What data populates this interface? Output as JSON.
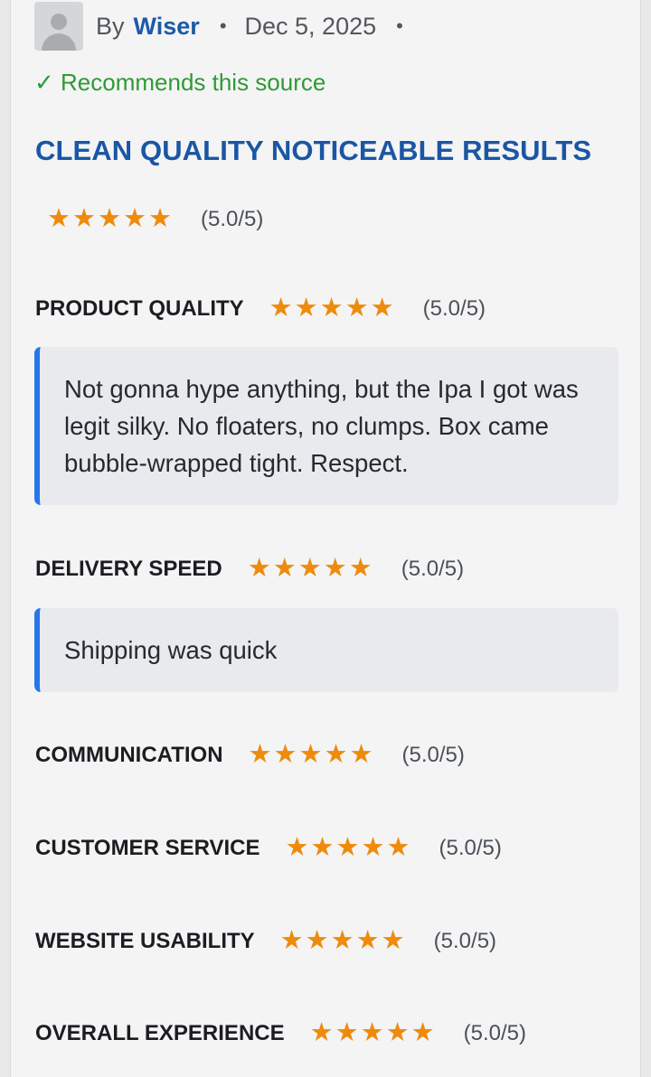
{
  "review": {
    "by_label": "By",
    "author": "Wiser",
    "separator": "•",
    "date": "Dec 5, 2025",
    "recommend_text": "✓ Recommends this source",
    "title": "CLEAN QUALITY NOTICEABLE RESULTS",
    "overall": {
      "stars": "★★★★★",
      "score_text": "(5.0/5)",
      "rating": 5.0
    }
  },
  "categories": [
    {
      "label": "PRODUCT QUALITY",
      "stars": "★★★★★",
      "score_text": "(5.0/5)",
      "rating": 5.0,
      "comment": "Not gonna hype anything, but the Ipa I got was legit silky. No floaters, no clumps. Box came bubble-wrapped tight. Respect."
    },
    {
      "label": "DELIVERY SPEED",
      "stars": "★★★★★",
      "score_text": "(5.0/5)",
      "rating": 5.0,
      "comment": "Shipping was quick"
    },
    {
      "label": "COMMUNICATION",
      "stars": "★★★★★",
      "score_text": "(5.0/5)",
      "rating": 5.0
    },
    {
      "label": "CUSTOMER SERVICE",
      "stars": "★★★★★",
      "score_text": "(5.0/5)",
      "rating": 5.0
    },
    {
      "label": "WEBSITE USABILITY",
      "stars": "★★★★★",
      "score_text": "(5.0/5)",
      "rating": 5.0
    },
    {
      "label": "OVERALL EXPERIENCE",
      "stars": "★★★★★",
      "score_text": "(5.0/5)",
      "rating": 5.0
    }
  ],
  "colors": {
    "author": "#1c5aa6",
    "recommend": "#2f9a34",
    "title": "#1a56a4",
    "star": "#ee8b0c",
    "comment_accent": "#2776ea"
  },
  "icons": {
    "avatar": "user-placeholder-icon",
    "check": "check-icon",
    "star": "star-icon"
  }
}
